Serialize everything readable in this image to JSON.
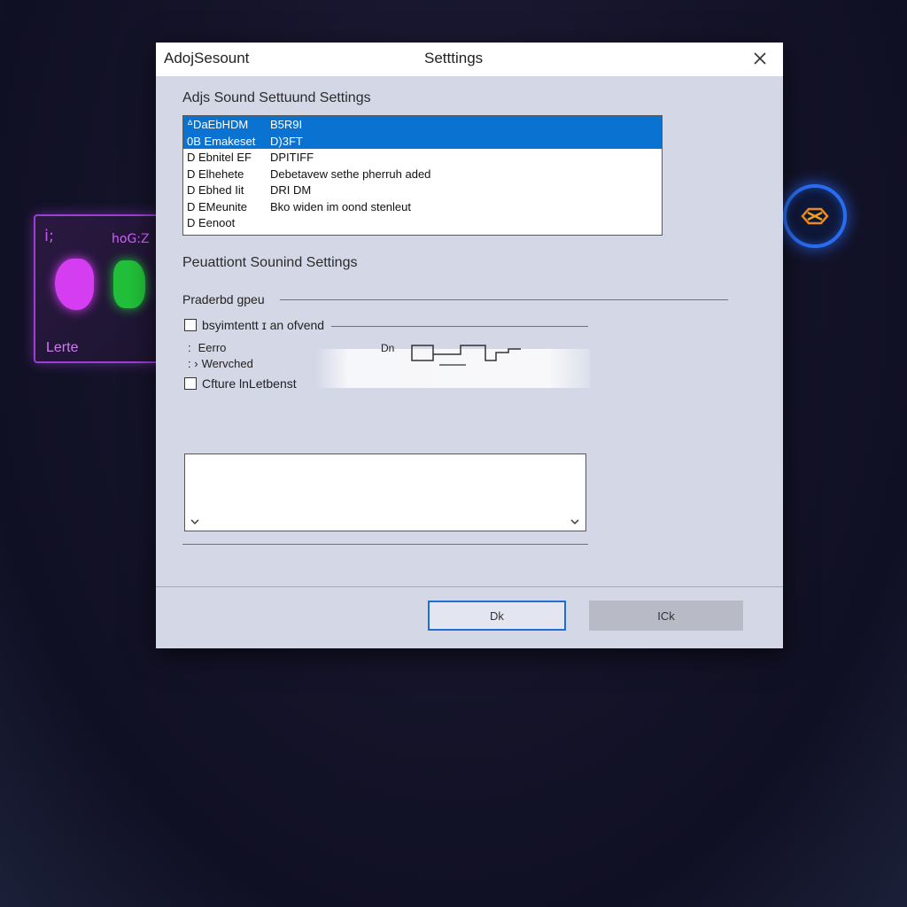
{
  "background": {
    "card": {
      "label": "Lerte",
      "tag": "hoG:Z",
      "corner": "i;"
    },
    "ring_icon": "hex-glyph-icon"
  },
  "dialog": {
    "title_left": "AdojSesount",
    "title_center": "Setttings",
    "heading": "Adjs Sound Settuund Settings",
    "list_rows": [
      {
        "c1": "ᐞDaEbHDM",
        "c2": "B5R9I",
        "selected": true
      },
      {
        "c1": "0B Emakeset",
        "c2": "D)3FT",
        "selected": true
      },
      {
        "c1": "D Ebnitel EF",
        "c2": "DPITIFF",
        "selected": false
      },
      {
        "c1": "D Elhehete",
        "c2": "Debetavew sethe pherruh aded",
        "selected": false
      },
      {
        "c1": "D Ebhed Iit",
        "c2": "DRI DM",
        "selected": false
      },
      {
        "c1": "D EMeunite",
        "c2": "Bko widen im oond stenleut",
        "selected": false
      },
      {
        "c1": "D Eenoot",
        "c2": "",
        "selected": false
      }
    ],
    "section_heading": "Peuattiont Sounind Settings",
    "subheading": "Praderbd gpeu",
    "checkbox1": "bsyimtentt ɪ an ofvend",
    "bullet1": "Eerro",
    "bullet2": "Wervched",
    "small_label": "Dn",
    "checkbox2": "Cfture lnLetbenst",
    "ok_label": "Dk",
    "cancel_label": "ICk"
  }
}
